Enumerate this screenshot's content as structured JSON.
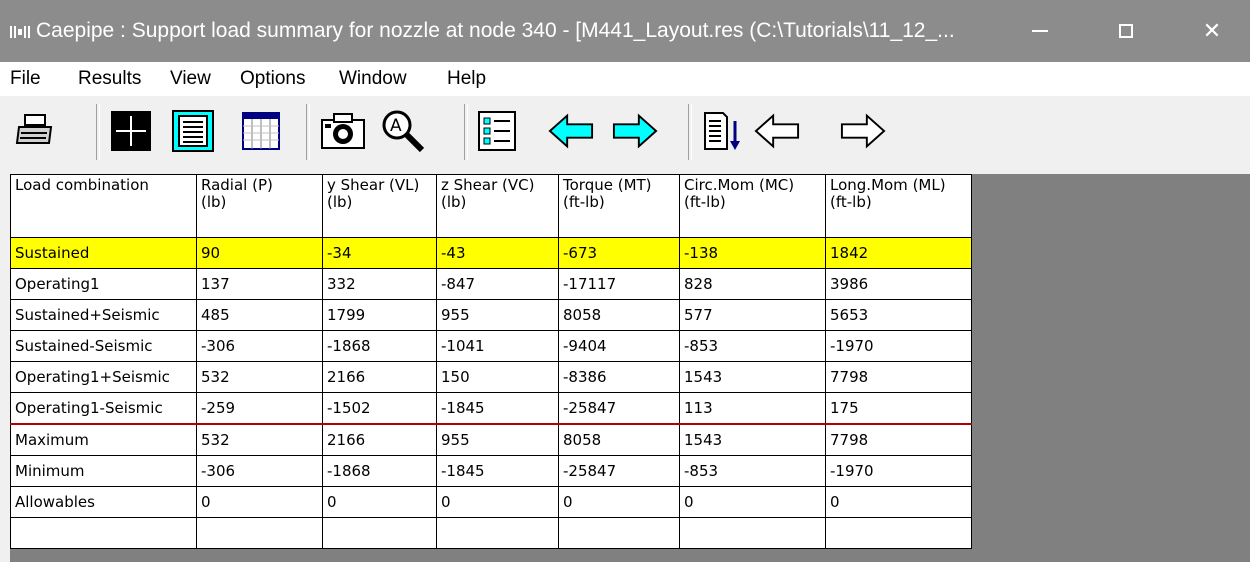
{
  "titlebar": {
    "title": "Caepipe : Support load summary for nozzle at node 340 -  [M441_Layout.res (C:\\Tutorials\\11_12_...",
    "minimize_icon": "minimize-icon",
    "maximize_icon": "maximize-icon",
    "close_icon": "close-icon",
    "close_glyph": "✕"
  },
  "menu": [
    {
      "label": "File"
    },
    {
      "label": "Results"
    },
    {
      "label": "View"
    },
    {
      "label": "Options"
    },
    {
      "label": "Window"
    },
    {
      "label": "Help"
    }
  ],
  "toolbar": {
    "icons": [
      "printer-icon",
      "crosshair-icon",
      "text-list-icon",
      "table-icon",
      "camera-icon",
      "magnify-icon",
      "legend-list-icon",
      "left-arrow-icon",
      "right-arrow-icon",
      "sort-down-icon",
      "left-arrow-outline-icon",
      "right-arrow-outline-icon"
    ],
    "colors": {
      "cyan": "#00ffff",
      "accent_dark": "#000080"
    }
  },
  "grid": {
    "headers": [
      {
        "line1": "Load combination",
        "line2": ""
      },
      {
        "line1": "Radial (P)",
        "line2": "(lb)"
      },
      {
        "line1": "y Shear (VL)",
        "line2": "(lb)"
      },
      {
        "line1": "z Shear (VC)",
        "line2": "(lb)"
      },
      {
        "line1": "Torque (MT)",
        "line2": "(ft-lb)"
      },
      {
        "line1": "Circ.Mom (MC)",
        "line2": "(ft-lb)"
      },
      {
        "line1": "Long.Mom (ML)",
        "line2": "(ft-lb)"
      }
    ],
    "rows": [
      [
        "Sustained",
        "90",
        "-34",
        "-43",
        "-673",
        "-138",
        "1842"
      ],
      [
        "Operating1",
        "137",
        "332",
        "-847",
        "-17117",
        "828",
        "3986"
      ],
      [
        "Sustained+Seismic",
        "485",
        "1799",
        "955",
        "8058",
        "577",
        "5653"
      ],
      [
        "Sustained-Seismic",
        "-306",
        "-1868",
        "-1041",
        "-9404",
        "-853",
        "-1970"
      ],
      [
        "Operating1+Seismic",
        "532",
        "2166",
        "150",
        "-8386",
        "1543",
        "7798"
      ],
      [
        "Operating1-Seismic",
        "-259",
        "-1502",
        "-1845",
        "-25847",
        "113",
        "175"
      ],
      [
        "Maximum",
        "532",
        "2166",
        "955",
        "8058",
        "1543",
        "7798"
      ],
      [
        "Minimum",
        "-306",
        "-1868",
        "-1845",
        "-25847",
        "-853",
        "-1970"
      ],
      [
        "Allowables",
        "0",
        "0",
        "0",
        "0",
        "0",
        "0"
      ],
      [
        "",
        "",
        "",
        "",
        "",
        "",
        ""
      ]
    ],
    "highlight_color": "#ffff00",
    "separator_color": "#b00000"
  }
}
